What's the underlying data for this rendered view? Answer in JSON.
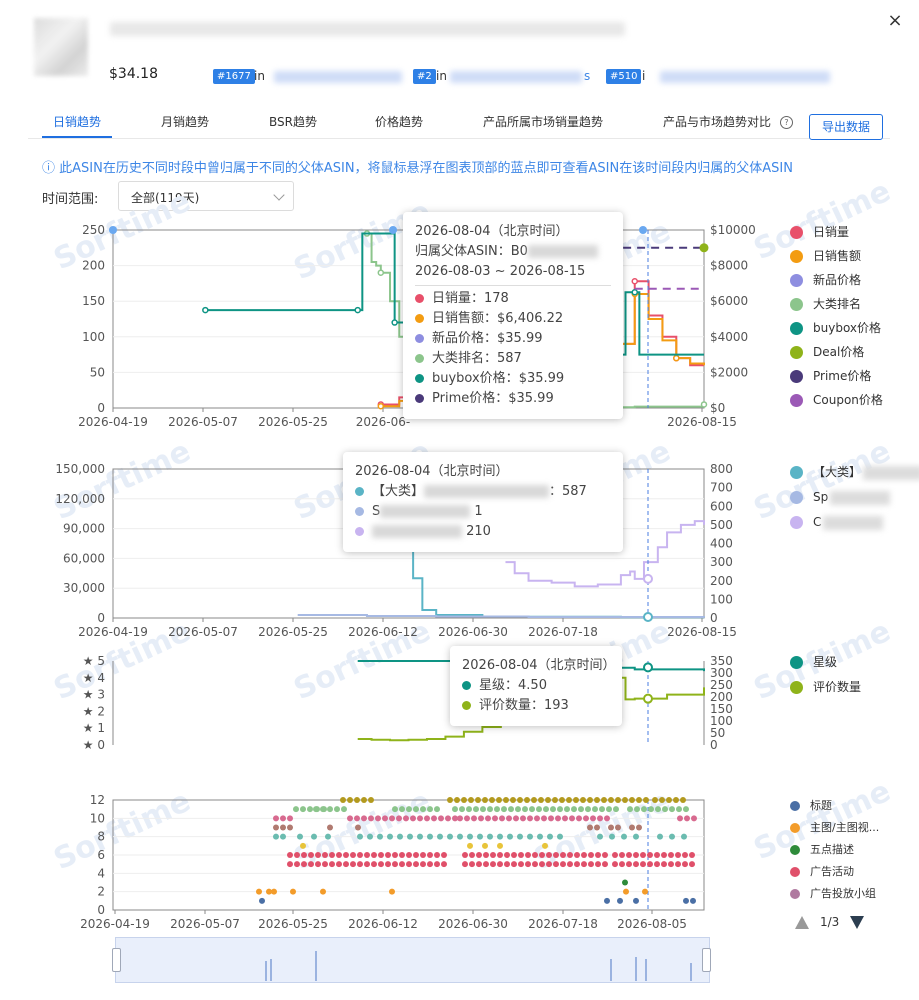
{
  "product": {
    "price": "$34.18",
    "ranks": [
      {
        "badge": "#1677",
        "prefix": "in"
      },
      {
        "badge": "#2",
        "prefix": "in"
      },
      {
        "badge": "#510",
        "prefix": "i"
      }
    ],
    "rank_suffix_2": "s"
  },
  "tabs": [
    "日销趋势",
    "月销趋势",
    "BSR趋势",
    "价格趋势",
    "产品所属市场销量趋势",
    "产品与市场趋势对比"
  ],
  "export_label": "导出数据",
  "help_icon": "?",
  "close_icon": "×",
  "notice": "ⓘ 此ASIN在历史不同时段中曾归属于不同的父体ASIN，将鼠标悬浮在图表顶部的蓝点即可查看ASIN在该时间段内归属的父体ASIN",
  "range": {
    "label": "时间范围:",
    "value": "全部(119天)"
  },
  "watermark": "Sorftime",
  "colors": {
    "daily_sales": "#e8506a",
    "daily_revenue": "#f39c12",
    "new_price": "#8e8ee0",
    "category_rank": "#8cc58c",
    "buybox": "#0e9484",
    "deal": "#8fb31a",
    "prime": "#4a3a7a",
    "coupon": "#9b59b6",
    "bsr_main": "#5ab4c6",
    "bsr_sub1": "#a6b9e3",
    "bsr_sub2": "#c8b4f0",
    "rating": "#0e9484",
    "review_count": "#8fb31a",
    "accent": "#1f6fe0"
  },
  "chart_data": [
    {
      "type": "line",
      "title": "daily",
      "x_ticks": [
        "2026-04-19",
        "2026-05-07",
        "2026-05-25",
        "2026-06-",
        "2026-08-15"
      ],
      "y_left_ticks": [
        "0",
        "50",
        "100",
        "150",
        "200",
        "250"
      ],
      "y_right_ticks": [
        "$0",
        "$2000",
        "$4000",
        "$6000",
        "$8000",
        "$10000"
      ],
      "y_left_range": [
        0,
        250
      ],
      "y_right_range": [
        0,
        10000
      ],
      "legend": [
        "日销量",
        "日销售额",
        "新品价格",
        "大类排名",
        "buybox价格",
        "Deal价格",
        "Prime价格",
        "Coupon价格"
      ],
      "series": [
        {
          "name": "日销量",
          "axis": "left",
          "values": [
            [
              58,
              5
            ],
            [
              62,
              15
            ],
            [
              65,
              35
            ],
            [
              68,
              60
            ],
            [
              71,
              95
            ],
            [
              74,
              120
            ],
            [
              77,
              150
            ],
            [
              80,
              120
            ],
            [
              83,
              110
            ],
            [
              86,
              100
            ],
            [
              89,
              95
            ],
            [
              92,
              85
            ],
            [
              95,
              90
            ],
            [
              98,
              100
            ],
            [
              101,
              130
            ],
            [
              104,
              110
            ],
            [
              107,
              100
            ],
            [
              110,
              90
            ],
            [
              113,
              178
            ],
            [
              116,
              130
            ],
            [
              119,
              100
            ],
            [
              122,
              70
            ],
            [
              125,
              60
            ],
            [
              128,
              60
            ]
          ]
        },
        {
          "name": "日销售额",
          "axis": "right",
          "values": [
            [
              58,
              100
            ],
            [
              62,
              400
            ],
            [
              65,
              1000
            ],
            [
              68,
              2000
            ],
            [
              71,
              3500
            ],
            [
              74,
              4500
            ],
            [
              77,
              6500
            ],
            [
              80,
              4800
            ],
            [
              83,
              4200
            ],
            [
              86,
              4000
            ],
            [
              89,
              3800
            ],
            [
              92,
              3500
            ],
            [
              95,
              3600
            ],
            [
              98,
              4000
            ],
            [
              101,
              5200
            ],
            [
              104,
              4400
            ],
            [
              107,
              4000
            ],
            [
              110,
              3600
            ],
            [
              113,
              6406.22
            ],
            [
              116,
              5000
            ],
            [
              119,
              3800
            ],
            [
              122,
              2800
            ],
            [
              125,
              2500
            ],
            [
              128,
              2400
            ]
          ]
        },
        {
          "name": "大类排名",
          "axis": "left",
          "values": [
            [
              55,
              245
            ],
            [
              56,
              205
            ],
            [
              57,
              200
            ],
            [
              58,
              190
            ],
            [
              60,
              150
            ],
            [
              62,
              100
            ],
            [
              64,
              60
            ],
            [
              66,
              30
            ],
            [
              68,
              10
            ],
            [
              70,
              5
            ],
            [
              75,
              3
            ],
            [
              80,
              2
            ],
            [
              90,
              1
            ],
            [
              100,
              1
            ],
            [
              113,
              2
            ],
            [
              128,
              5
            ]
          ]
        },
        {
          "name": "buybox价格",
          "axis": "right",
          "values": [
            [
              20,
              5500
            ],
            [
              30,
              5500
            ],
            [
              40,
              5500
            ],
            [
              53,
              5500
            ],
            [
              54,
              9800
            ],
            [
              60,
              9800
            ],
            [
              61,
              4800
            ],
            [
              63,
              4800
            ],
            [
              64,
              3000
            ],
            [
              74,
              3000
            ],
            [
              75,
              4900
            ],
            [
              77,
              4900
            ],
            [
              78,
              3000
            ],
            [
              110,
              3000
            ],
            [
              111,
              6500
            ],
            [
              113,
              6500
            ],
            [
              114,
              3000
            ],
            [
              128,
              3000
            ]
          ]
        },
        {
          "name": "Prime价格",
          "axis": "right",
          "values": [
            [
              65,
              9000
            ],
            [
              113,
              9000
            ],
            [
              128,
              9000
            ]
          ]
        },
        {
          "name": "Coupon价格",
          "axis": "right",
          "values": [
            [
              113,
              6700
            ],
            [
              128,
              6700
            ]
          ]
        },
        {
          "name": "Deal价格",
          "axis": "right",
          "values": [
            [
              67,
              9000
            ],
            [
              72,
              9000
            ],
            [
              74,
              9000
            ],
            [
              77,
              9000
            ],
            [
              80,
              9000
            ],
            [
              83,
              9000
            ],
            [
              86,
              9000
            ],
            [
              128,
              9000
            ]
          ]
        }
      ]
    },
    {
      "type": "line",
      "title": "bsr",
      "x_ticks": [
        "2026-04-19",
        "2026-05-07",
        "2026-05-25",
        "2026-06-12",
        "2026-06-30",
        "2026-07-18",
        "2026-08-15"
      ],
      "y_left_ticks": [
        "0",
        "30,000",
        "60,000",
        "90,000",
        "120,000",
        "150,000"
      ],
      "y_right_ticks": [
        "0",
        "100",
        "200",
        "300",
        "400",
        "500",
        "600",
        "700",
        "800"
      ],
      "y_left_range": [
        0,
        150000
      ],
      "y_right_range": [
        0,
        800
      ],
      "legend": [
        "【大类】",
        "Sp",
        "C"
      ],
      "series": [
        {
          "name": "【大类】",
          "axis": "left",
          "values": [
            [
              55,
              145000
            ],
            [
              57,
              130000
            ],
            [
              59,
              120000
            ],
            [
              61,
              110000
            ],
            [
              63,
              90000
            ],
            [
              65,
              40000
            ],
            [
              67,
              8000
            ],
            [
              70,
              3000
            ],
            [
              80,
              1500
            ],
            [
              90,
              1200
            ],
            [
              110,
              800
            ],
            [
              128,
              600
            ]
          ]
        },
        {
          "name": "Sp",
          "axis": "left",
          "values": [
            [
              40,
              3000
            ],
            [
              55,
              2000
            ],
            [
              70,
              1500
            ],
            [
              90,
              1000
            ],
            [
              128,
              800
            ]
          ]
        },
        {
          "name": "C",
          "axis": "right",
          "values": [
            [
              85,
              300
            ],
            [
              87,
              240
            ],
            [
              90,
              200
            ],
            [
              95,
              190
            ],
            [
              100,
              170
            ],
            [
              105,
              180
            ],
            [
              110,
              230
            ],
            [
              112,
              250
            ],
            [
              113,
              210
            ],
            [
              115,
              300
            ],
            [
              118,
              380
            ],
            [
              120,
              460
            ],
            [
              123,
              500
            ],
            [
              126,
              520
            ],
            [
              128,
              500
            ]
          ]
        }
      ]
    },
    {
      "type": "line",
      "title": "rating",
      "y_left_ticks": [
        "★ 0",
        "★ 1",
        "★ 2",
        "★ 3",
        "★ 4",
        "★ 5"
      ],
      "y_right_ticks": [
        "0",
        "50",
        "100",
        "150",
        "200",
        "250",
        "300",
        "350"
      ],
      "y_left_range": [
        0,
        5
      ],
      "y_right_range": [
        0,
        350
      ],
      "legend": [
        "星级",
        "评价数量"
      ],
      "series": [
        {
          "name": "星级",
          "axis": "left",
          "values": [
            [
              53,
              5
            ],
            [
              56,
              5
            ],
            [
              70,
              5
            ],
            [
              75,
              5
            ],
            [
              80,
              5
            ],
            [
              90,
              4.9
            ],
            [
              100,
              4.8
            ],
            [
              110,
              4.6
            ],
            [
              113,
              4.5
            ],
            [
              128,
              4.4
            ]
          ]
        },
        {
          "name": "评价数量",
          "axis": "right",
          "values": [
            [
              53,
              25
            ],
            [
              56,
              22
            ],
            [
              60,
              20
            ],
            [
              64,
              22
            ],
            [
              68,
              25
            ],
            [
              72,
              35
            ],
            [
              76,
              55
            ],
            [
              80,
              75
            ],
            [
              84,
              95
            ],
            [
              88,
              110
            ],
            [
              92,
              130
            ],
            [
              96,
              150
            ],
            [
              100,
              165
            ],
            [
              104,
              190
            ],
            [
              108,
              215
            ],
            [
              110,
              280
            ],
            [
              111,
              190
            ],
            [
              113,
              193
            ],
            [
              120,
              210
            ],
            [
              128,
              240
            ]
          ]
        }
      ]
    },
    {
      "type": "scatter",
      "title": "listing-changes",
      "x_ticks": [
        "2026-04-19",
        "2026-05-07",
        "2026-05-25",
        "2026-06-12",
        "2026-06-30",
        "2026-07-18",
        "2026-08-05"
      ],
      "y_ticks": [
        "0",
        "2",
        "4",
        "6",
        "8",
        "10",
        "12"
      ],
      "y_range": [
        0,
        12
      ],
      "legend": [
        "标题",
        "主图/主图视...",
        "五点描述",
        "广告活动",
        "广告投放小组"
      ],
      "pager": "1/3"
    }
  ],
  "tooltips": {
    "t1": {
      "date": "2026-08-04（北京时间）",
      "parent_label": "归属父体ASIN：",
      "parent_value": "B0",
      "period": "2026-08-03 ~ 2026-08-15",
      "rows": [
        {
          "label": "日销量：",
          "value": "178"
        },
        {
          "label": "日销售额：",
          "value": "$6,406.22"
        },
        {
          "label": "新品价格：",
          "value": "$35.99"
        },
        {
          "label": "大类排名：",
          "value": "587"
        },
        {
          "label": "buybox价格：",
          "value": "$35.99"
        },
        {
          "label": "Prime价格：",
          "value": "$35.99"
        }
      ]
    },
    "t2": {
      "date": "2026-08-04（北京时间）",
      "rows": [
        {
          "label": "【大类】",
          "value": "：587"
        },
        {
          "label": "S",
          "value": "1"
        },
        {
          "label": "",
          "value": "210"
        }
      ]
    },
    "t3": {
      "date": "2026-08-04（北京时间）",
      "rows": [
        {
          "label": "星级：",
          "value": "4.50"
        },
        {
          "label": "评价数量：",
          "value": "193"
        }
      ]
    }
  }
}
